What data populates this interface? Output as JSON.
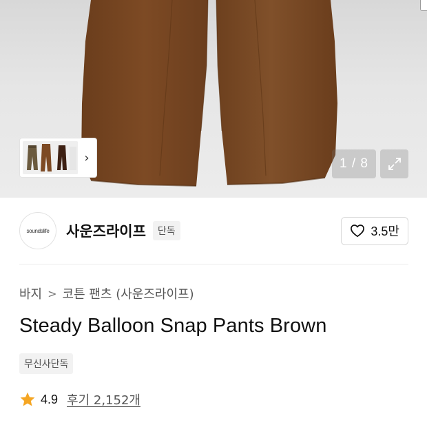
{
  "gallery": {
    "counter": "1 / 8",
    "current_image": 1,
    "total_images": 8,
    "thumbnail_next_glyph": "›",
    "product_color": "#7a4a24"
  },
  "brand": {
    "logo_text": "soundslife",
    "name": "사운즈라이프",
    "badge": "단독",
    "likes": "3.5만"
  },
  "breadcrumb": {
    "items": [
      "바지",
      "코튼 팬츠 (사운즈라이프)"
    ],
    "separator": ">"
  },
  "product": {
    "title": "Steady Balloon Snap Pants Brown",
    "tag": "무신사단독"
  },
  "rating": {
    "score": "4.9",
    "reviews_link": "후기 2,152개",
    "star_color": "#f5a623"
  },
  "icons": {
    "like": "heart-icon",
    "expand": "expand-icon",
    "star": "star-icon",
    "next": "chevron-right-icon"
  }
}
